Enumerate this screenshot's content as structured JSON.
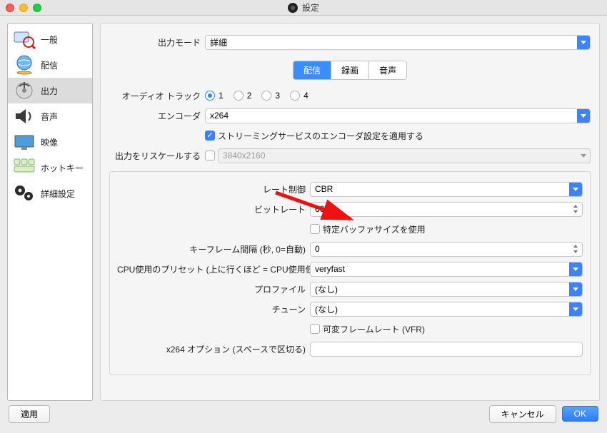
{
  "window": {
    "title": "設定"
  },
  "sidebar": {
    "items": [
      {
        "label": "一般"
      },
      {
        "label": "配信"
      },
      {
        "label": "出力"
      },
      {
        "label": "音声"
      },
      {
        "label": "映像"
      },
      {
        "label": "ホットキー"
      },
      {
        "label": "詳細設定"
      }
    ],
    "selected_index": 2
  },
  "top": {
    "output_mode_label": "出力モード",
    "output_mode_value": "詳細"
  },
  "tabs": {
    "stream": "配信",
    "record": "録画",
    "audio": "音声"
  },
  "mid": {
    "audio_track_label": "オーディオ トラック",
    "track_options": [
      "1",
      "2",
      "3",
      "4"
    ],
    "track_selected": "1",
    "encoder_label": "エンコーダ",
    "encoder_value": "x264",
    "enforce_label": "ストリーミングサービスのエンコーダ設定を適用する",
    "enforce_checked": true,
    "rescale_label": "出力をリスケールする",
    "rescale_checked": false,
    "rescale_value": "3840x2160"
  },
  "enc": {
    "rate_control_label": "レート制御",
    "rate_control_value": "CBR",
    "bitrate_label": "ビットレート",
    "bitrate_value": "6000",
    "custom_buffer_checked": false,
    "custom_buffer_label": "特定バッファサイズを使用",
    "keyint_label": "キーフレーム間隔 (秒, 0=自動)",
    "keyint_value": "0",
    "preset_label": "CPU使用のプリセット (上に行くほど = CPU使用低い)",
    "preset_value": "veryfast",
    "profile_label": "プロファイル",
    "profile_value": "(なし)",
    "tune_label": "チューン",
    "tune_value": "(なし)",
    "vfr_checked": false,
    "vfr_label": "可変フレームレート (VFR)",
    "x264opts_label": "x264 オプション (スペースで区切る)",
    "x264opts_value": ""
  },
  "buttons": {
    "apply": "適用",
    "cancel": "キャンセル",
    "ok": "OK"
  }
}
